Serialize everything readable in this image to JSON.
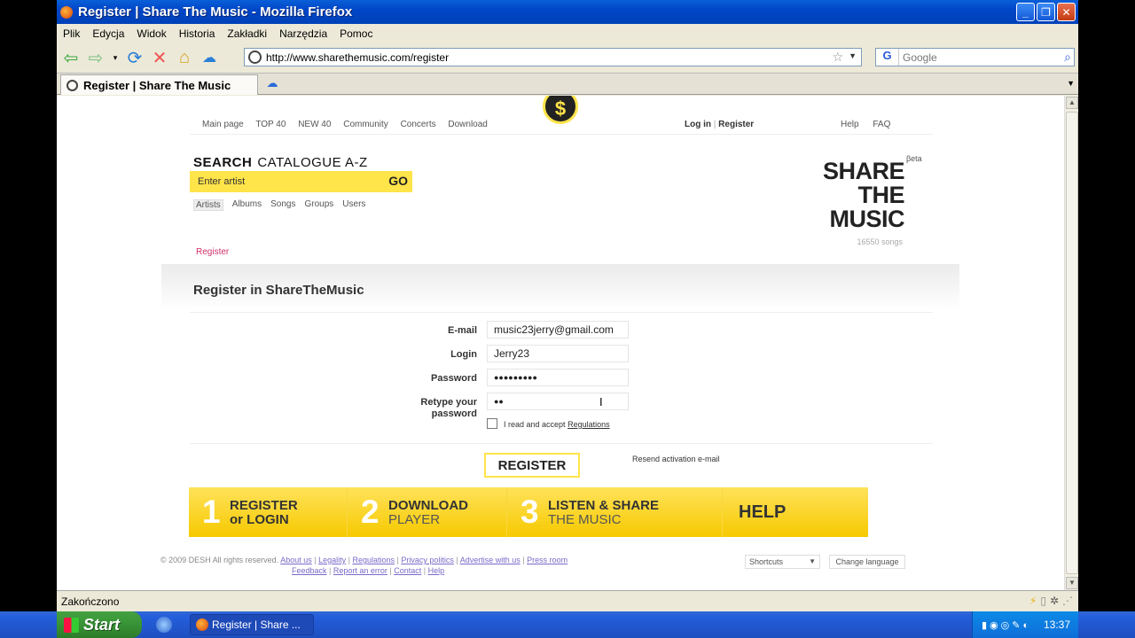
{
  "window": {
    "title": "Register | Share The Music - Mozilla Firefox"
  },
  "menu": [
    "Plik",
    "Edycja",
    "Widok",
    "Historia",
    "Zakładki",
    "Narzędzia",
    "Pomoc"
  ],
  "navbar": {
    "url": "http://www.sharethemusic.com/register",
    "search_placeholder": "Google"
  },
  "tab": {
    "title": "Register | Share The Music"
  },
  "site": {
    "topnav": [
      "Main page",
      "TOP 40",
      "NEW 40",
      "Community",
      "Concerts",
      "Download"
    ],
    "login": "Log in",
    "register_link": "Register",
    "help": [
      "Help",
      "FAQ"
    ],
    "search_title": "SEARCH",
    "catalogue": "CATALOGUE A-Z",
    "search_placeholder": "Enter artist",
    "go": "GO",
    "search_tabs": [
      "Artists",
      "Albums",
      "Songs",
      "Groups",
      "Users"
    ],
    "logo_lines": [
      "SHARE",
      "THE",
      "MUSIC"
    ],
    "beta": "βeta",
    "songs_count": "16550 songs",
    "breadcrumb": "Register",
    "page_title": "Register in ShareTheMusic"
  },
  "form": {
    "email_label": "E-mail",
    "email_value": "music23jerry@gmail.com",
    "login_label": "Login",
    "login_value": "Jerry23",
    "password_label": "Password",
    "password_value": "●●●●●●●●●",
    "retype_label": "Retype your password",
    "retype_value": "●●",
    "accept_text": "I read and accept",
    "regulations": "Regulations",
    "register_button": "REGISTER",
    "resend": "Resend activation e-mail"
  },
  "steps": [
    {
      "num": "1",
      "line1": "REGISTER",
      "line2": "or LOGIN"
    },
    {
      "num": "2",
      "line1": "DOWNLOAD",
      "line2": "PLAYER"
    },
    {
      "num": "3",
      "line1": "LISTEN & SHARE",
      "line2": "THE MUSIC"
    },
    {
      "help": "HELP"
    }
  ],
  "footer": {
    "copyright": "© 2009 DESH All rights reserved.",
    "links1": [
      "About us",
      "Legality",
      "Regulations",
      "Privacy politics",
      "Advertise with us",
      "Press room"
    ],
    "links2": [
      "Feedback",
      "Report an error",
      "Contact",
      "Help"
    ],
    "shortcuts": "Shortcuts",
    "change_language": "Change language"
  },
  "status": {
    "text": "Zakończono"
  },
  "taskbar": {
    "start": "Start",
    "task": "Register | Share ...",
    "time": "13:37"
  },
  "colors": {
    "accent_yellow": "#ffe44a",
    "breadcrumb_pink": "#d0306a",
    "xp_blue": "#245edb"
  }
}
